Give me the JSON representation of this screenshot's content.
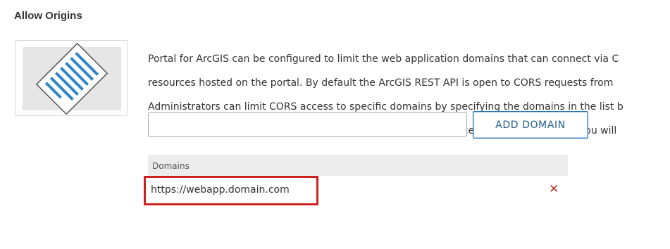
{
  "section": {
    "title": "Allow Origins"
  },
  "illustration": {
    "icon": "document-icon"
  },
  "description": {
    "lines": [
      "Portal for ArcGIS can be configured to limit the web application domains that can connect via C",
      "resources hosted on the portal. By default the ArcGIS REST API is open to CORS requests from",
      "Administrators can limit CORS access to specific domains by specifying the domains in the list b",
      "application hosted on acme.com and you want to limit CORS access to only acme.com you will"
    ]
  },
  "form": {
    "domain_input_value": "",
    "add_button_label": "ADD DOMAIN"
  },
  "table": {
    "header": "Domains",
    "rows": [
      {
        "domain": "https://webapp.domain.com",
        "remove_icon": "remove-x-icon"
      }
    ]
  },
  "colors": {
    "highlight": "#d0201e",
    "remove_icon": "#c0392b",
    "button_border": "#2b79b8",
    "header_bg": "#ececec"
  }
}
